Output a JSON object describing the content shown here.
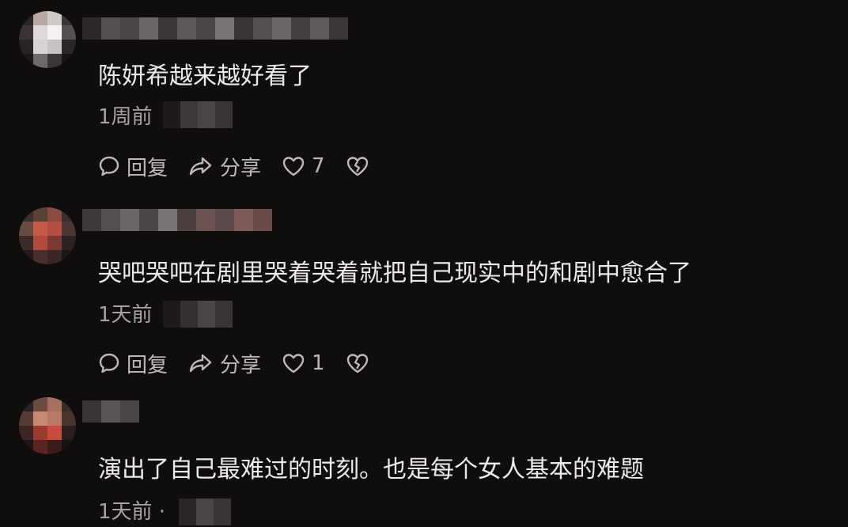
{
  "comments": [
    {
      "text": "陈妍希越来越好看了",
      "time": "1周前",
      "reply_label": "回复",
      "share_label": "分享",
      "like_count": "7"
    },
    {
      "text": "哭吧哭吧在剧里哭着哭着就把自己现实中的和剧中愈合了",
      "time": "1天前",
      "reply_label": "回复",
      "share_label": "分享",
      "like_count": "1"
    },
    {
      "text": "演出了自己最难过的时刻。也是每个女人基本的难题",
      "time": "1天前 ·"
    }
  ],
  "icons": {
    "reply": "comment-bubble-icon",
    "share": "share-arrow-icon",
    "like": "heart-icon",
    "dislike": "broken-heart-icon"
  },
  "colors": {
    "background": "#100d0d",
    "text": "#ece9e9",
    "meta": "#a6a2a2"
  }
}
